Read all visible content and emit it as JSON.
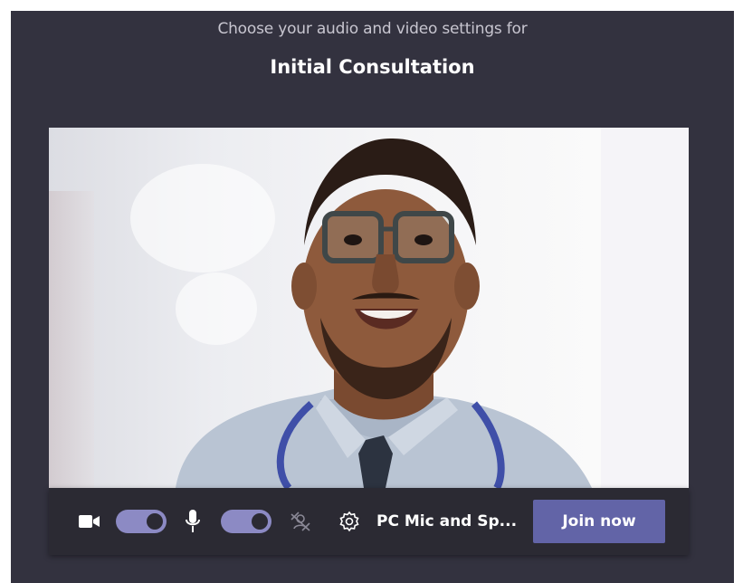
{
  "header": {
    "subtitle": "Choose your audio and video settings for",
    "meeting_title": "Initial Consultation"
  },
  "controls": {
    "camera": {
      "icon": "video-camera-icon",
      "on": true
    },
    "microphone": {
      "icon": "microphone-icon",
      "on": true
    },
    "background_effects": {
      "icon": "background-blur-icon"
    },
    "device_settings": {
      "icon": "gear-icon",
      "label": "PC Mic and Sp..."
    },
    "join_label": "Join now"
  },
  "colors": {
    "background": "#33323f",
    "control_bar": "#2b2a33",
    "accent": "#6264a7",
    "toggle_on": "#8c8ac4"
  }
}
